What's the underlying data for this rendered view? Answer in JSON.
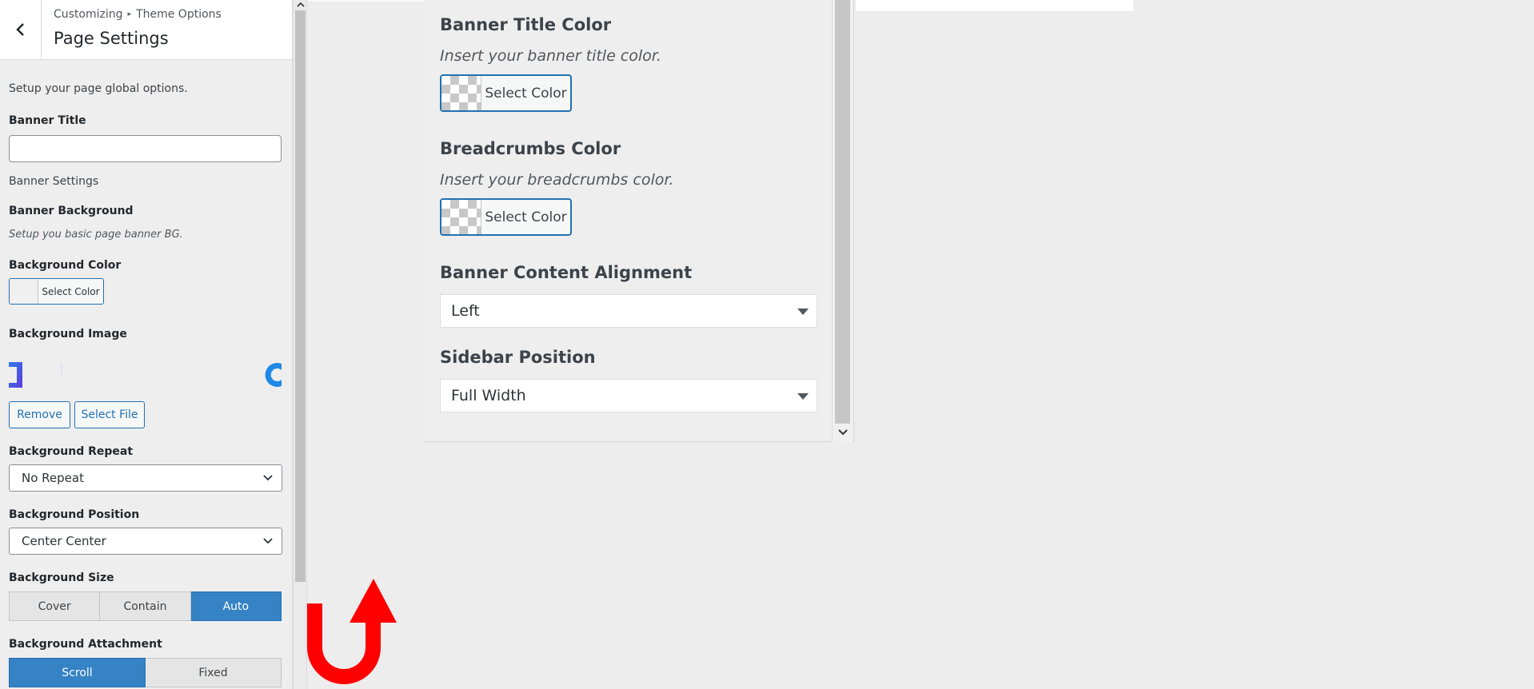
{
  "header": {
    "breadcrumb_root": "Customizing",
    "breadcrumb_sep": "▸",
    "breadcrumb_parent": "Theme Options",
    "title": "Page Settings"
  },
  "panel": {
    "intro": "Setup your page global options.",
    "banner_title_label": "Banner Title",
    "banner_title_value": "",
    "banner_settings_label": "Banner Settings",
    "banner_background_label": "Banner Background",
    "banner_background_desc": "Setup you basic page banner BG.",
    "background_color_label": "Background Color",
    "select_color": "Select Color",
    "background_image_label": "Background Image",
    "remove_button": "Remove",
    "select_file_button": "Select File",
    "background_repeat_label": "Background Repeat",
    "background_repeat_value": "No Repeat",
    "background_position_label": "Background Position",
    "background_position_value": "Center Center",
    "background_size_label": "Background Size",
    "background_size_options": [
      "Cover",
      "Contain",
      "Auto"
    ],
    "background_size_selected": "Auto",
    "background_attachment_label": "Background Attachment",
    "background_attachment_options": [
      "Scroll",
      "Fixed"
    ],
    "background_attachment_selected": "Scroll"
  },
  "zoom": {
    "banner_title_color_label": "Banner Title Color",
    "banner_title_color_desc": "Insert your banner title color.",
    "breadcrumbs_color_label": "Breadcrumbs Color",
    "breadcrumbs_color_desc": "Insert your breadcrumbs color.",
    "select_color": "Select Color",
    "banner_alignment_label": "Banner Content Alignment",
    "banner_alignment_value": "Left",
    "sidebar_position_label": "Sidebar Position",
    "sidebar_position_value": "Full Width"
  },
  "icons": {
    "back": "chevron-left-icon",
    "scroll_up": "chevron-up-icon",
    "scroll_down": "chevron-down-icon",
    "annotation": "red-u-turn-arrow-icon"
  },
  "colors": {
    "accent": "#2271b1",
    "active_segment": "#3582c4",
    "annotation_arrow": "#ff0000"
  }
}
